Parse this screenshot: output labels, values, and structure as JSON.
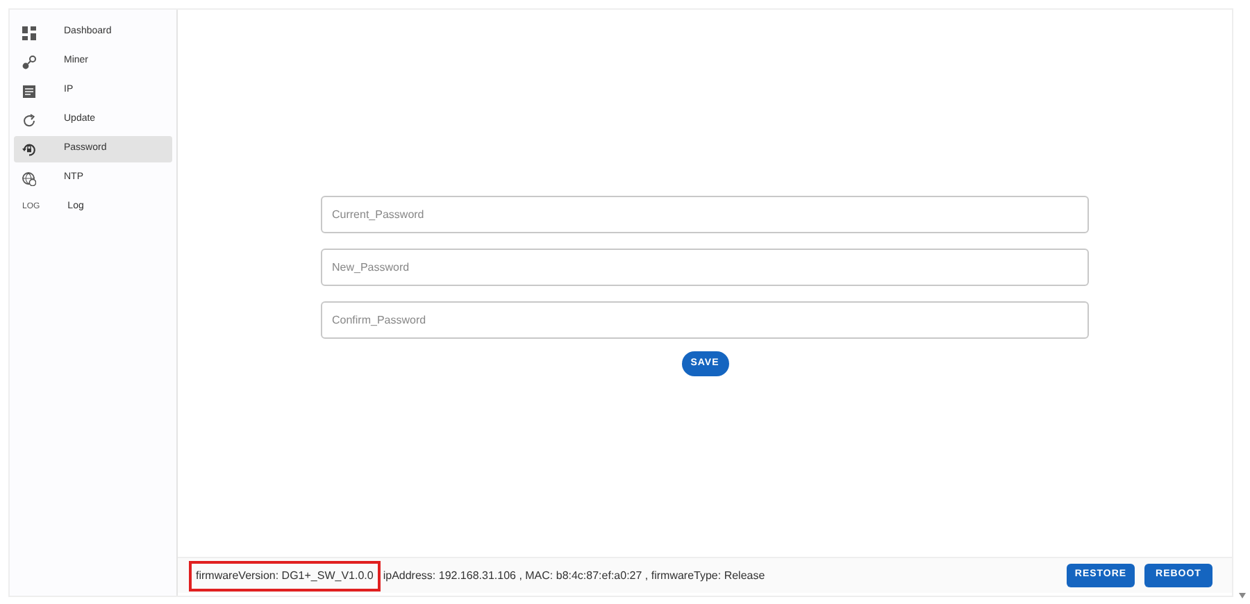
{
  "sidebar": {
    "items": [
      {
        "label": "Dashboard",
        "selected": false
      },
      {
        "label": "Miner",
        "selected": false
      },
      {
        "label": "IP",
        "selected": false
      },
      {
        "label": "Update",
        "selected": false
      },
      {
        "label": "Password",
        "selected": true
      },
      {
        "label": "NTP",
        "selected": false
      },
      {
        "label": "Log",
        "selected": false,
        "icon_text": "LOG"
      }
    ]
  },
  "form": {
    "fields": [
      {
        "placeholder": "Current_Password"
      },
      {
        "placeholder": "New_Password"
      },
      {
        "placeholder": "Confirm_Password"
      }
    ],
    "save_button": "SAVE"
  },
  "footer": {
    "firmware_version": "firmwareVersion: DG1+_SW_V1.0.0",
    "highlighted": true,
    "device_info": "ipAddress: 192.168.31.106 , MAC: b8:4c:87:ef:a0:27 , firmwareType: Release",
    "buttons": [
      "RESTORE",
      "REBOOT"
    ]
  }
}
